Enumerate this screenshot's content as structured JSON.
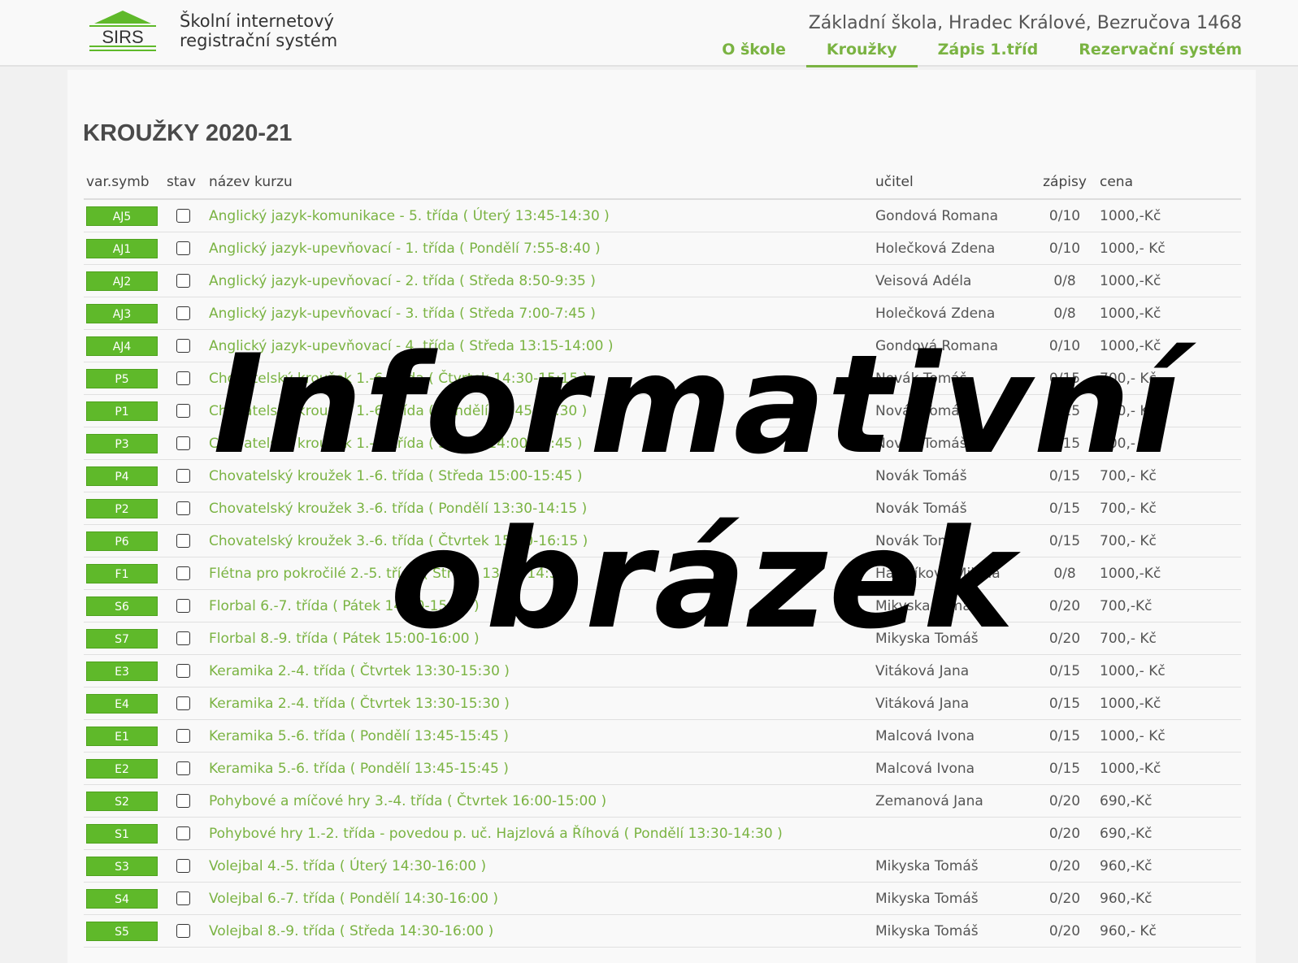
{
  "header": {
    "logo_text": "SIRS",
    "system_name_line1": "Školní internetový",
    "system_name_line2": "registrační systém",
    "school_name": "Základní škola, Hradec Králové, Bezručova 1468",
    "nav": [
      {
        "label": "O škole",
        "active": false
      },
      {
        "label": "Kroužky",
        "active": true
      },
      {
        "label": "Zápis 1.tříd",
        "active": false
      },
      {
        "label": "Rezervační systém",
        "active": false
      }
    ]
  },
  "page_title": "KROUŽKY 2020-21",
  "table": {
    "headers": {
      "sym": "var.symb",
      "stav": "stav",
      "name": "název kurzu",
      "teacher": "učitel",
      "zapisy": "zápisy",
      "price": "cena"
    },
    "rows": [
      {
        "sym": "AJ5",
        "name": "Anglický jazyk-komunikace - 5. třída ( Úterý 13:45-14:30 )",
        "teacher": "Gondová Romana",
        "zapisy": "0/10",
        "price": "1000,-Kč"
      },
      {
        "sym": "AJ1",
        "name": "Anglický jazyk-upevňovací - 1. třída ( Pondělí 7:55-8:40 )",
        "teacher": "Holečková Zdena",
        "zapisy": "0/10",
        "price": "1000,- Kč"
      },
      {
        "sym": "AJ2",
        "name": "Anglický jazyk-upevňovací - 2. třída ( Středa 8:50-9:35 )",
        "teacher": "Veisová Adéla",
        "zapisy": "0/8",
        "price": "1000,-Kč"
      },
      {
        "sym": "AJ3",
        "name": "Anglický jazyk-upevňovací - 3. třída ( Středa 7:00-7:45 )",
        "teacher": "Holečková Zdena",
        "zapisy": "0/8",
        "price": "1000,-Kč"
      },
      {
        "sym": "AJ4",
        "name": "Anglický jazyk-upevňovací - 4. třída ( Středa 13:15-14:00 )",
        "teacher": "Gondová Romana",
        "zapisy": "0/10",
        "price": "1000,-Kč"
      },
      {
        "sym": "P5",
        "name": "Chovatelský kroužek 1.-6. třída ( Čtvrtek 14:30-15:15 )",
        "teacher": "Novák Tomáš",
        "zapisy": "0/15",
        "price": "700,- Kč"
      },
      {
        "sym": "P1",
        "name": "Chovatelský kroužek 1.-6. třída ( Pondělí 12:45-13:30 )",
        "teacher": "Novák Tomáš",
        "zapisy": "0/15",
        "price": "700,- Kč"
      },
      {
        "sym": "P3",
        "name": "Chovatelský kroužek 1.-6. třída ( Středa 14:00-14:45 )",
        "teacher": "Novák Tomáš",
        "zapisy": "0/15",
        "price": "700,- Kč"
      },
      {
        "sym": "P4",
        "name": "Chovatelský kroužek 1.-6. třída ( Středa 15:00-15:45 )",
        "teacher": "Novák Tomáš",
        "zapisy": "0/15",
        "price": "700,- Kč"
      },
      {
        "sym": "P2",
        "name": "Chovatelský kroužek 3.-6. třída ( Pondělí 13:30-14:15 )",
        "teacher": "Novák Tomáš",
        "zapisy": "0/15",
        "price": "700,- Kč"
      },
      {
        "sym": "P6",
        "name": "Chovatelský kroužek 3.-6. třída ( Čtvrtek 15:30-16:15 )",
        "teacher": "Novák Tomáš",
        "zapisy": "0/15",
        "price": "700,- Kč"
      },
      {
        "sym": "F1",
        "name": "Flétna pro pokročilé 2.-5. třída ( Středa 13:30-14:30 )",
        "teacher": "Hanzlíková Milada",
        "zapisy": "0/8",
        "price": "1000,-Kč"
      },
      {
        "sym": "S6",
        "name": "Florbal 6.-7. třída ( Pátek 14:00-15:00 )",
        "teacher": "Mikyska Tomáš",
        "zapisy": "0/20",
        "price": "700,-Kč"
      },
      {
        "sym": "S7",
        "name": "Florbal 8.-9. třída ( Pátek 15:00-16:00 )",
        "teacher": "Mikyska Tomáš",
        "zapisy": "0/20",
        "price": "700,- Kč"
      },
      {
        "sym": "E3",
        "name": "Keramika 2.-4. třída ( Čtvrtek 13:30-15:30 )",
        "teacher": "Vitáková Jana",
        "zapisy": "0/15",
        "price": "1000,- Kč"
      },
      {
        "sym": "E4",
        "name": "Keramika 2.-4. třída ( Čtvrtek 13:30-15:30 )",
        "teacher": "Vitáková Jana",
        "zapisy": "0/15",
        "price": "1000,-Kč"
      },
      {
        "sym": "E1",
        "name": "Keramika 5.-6. třída ( Pondělí 13:45-15:45 )",
        "teacher": "Malcová Ivona",
        "zapisy": "0/15",
        "price": "1000,- Kč"
      },
      {
        "sym": "E2",
        "name": "Keramika 5.-6. třída ( Pondělí 13:45-15:45 )",
        "teacher": "Malcová Ivona",
        "zapisy": "0/15",
        "price": "1000,-Kč"
      },
      {
        "sym": "S2",
        "name": "Pohybové a míčové hry 3.-4. třída ( Čtvrtek 16:00-15:00 )",
        "teacher": "Zemanová Jana",
        "zapisy": "0/20",
        "price": "690,-Kč"
      },
      {
        "sym": "S1",
        "name": "Pohybové hry 1.-2. třída - povedou p. uč. Hajzlová a Říhová ( Pondělí 13:30-14:30 )",
        "teacher": "",
        "zapisy": "0/20",
        "price": "690,-Kč"
      },
      {
        "sym": "S3",
        "name": "Volejbal 4.-5. třída ( Úterý 14:30-16:00 )",
        "teacher": "Mikyska Tomáš",
        "zapisy": "0/20",
        "price": "960,-Kč"
      },
      {
        "sym": "S4",
        "name": "Volejbal 6.-7. třída ( Pondělí 14:30-16:00 )",
        "teacher": "Mikyska Tomáš",
        "zapisy": "0/20",
        "price": "960,-Kč"
      },
      {
        "sym": "S5",
        "name": "Volejbal 8.-9. třída ( Středa 14:30-16:00 )",
        "teacher": "Mikyska Tomáš",
        "zapisy": "0/20",
        "price": "960,- Kč"
      }
    ]
  },
  "watermark": {
    "line1": "Informativní",
    "line2": "obrázek"
  },
  "colors": {
    "accent_green": "#7ab342",
    "badge_green": "#5fb92a"
  }
}
